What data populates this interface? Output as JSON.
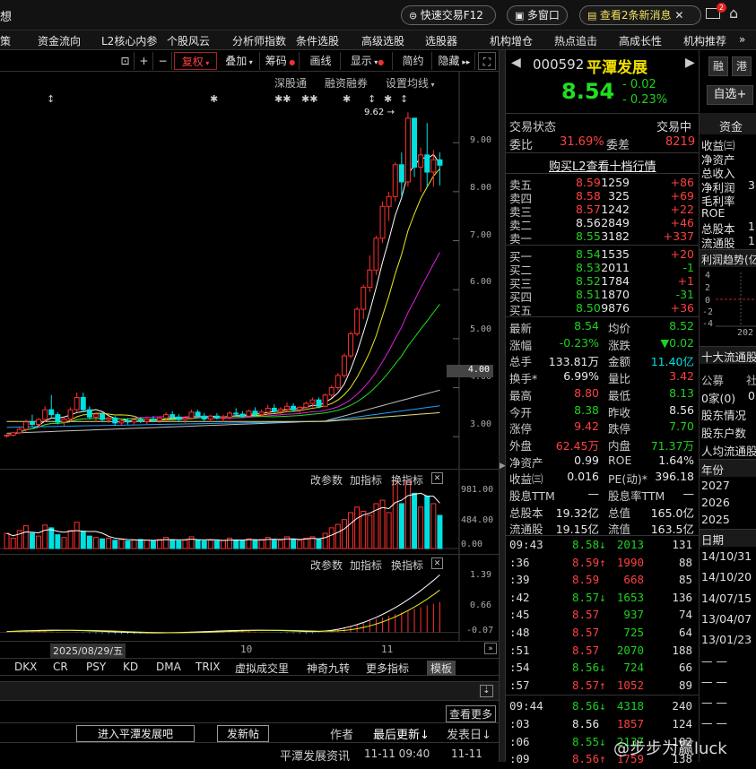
{
  "topbar": {
    "left_fragment": "想",
    "quick_trade": "快速交易F12",
    "multi_window": "多窗口",
    "news": "查看2条新消息",
    "mail_badge": "2"
  },
  "menu": [
    "策",
    "资金流向",
    "L2核心内参",
    "个股风云",
    "分析师指数",
    "条件选股",
    "高级选股",
    "选股器",
    "机构增仓",
    "热点追击",
    "高成长性",
    "机构推荐"
  ],
  "toolbar": {
    "fuquan": "复权",
    "diejia": "叠加",
    "chouma": "筹码",
    "huaxian": "画线",
    "xianshi": "显示",
    "jianyue": "简约",
    "yincang": "隐藏"
  },
  "chart_tags": {
    "shengutong": "深股通",
    "rongzi": "融资融券",
    "shezhi": "设置均线"
  },
  "chart_data": {
    "type": "candlestick",
    "price_axis": [
      "9.00",
      "8.00",
      "7.00",
      "6.00",
      "5.00",
      "4.00",
      "3.00"
    ],
    "price_range": [
      2.4,
      9.9
    ],
    "current_price_label": "4.00",
    "high_marker": "9.62",
    "candles": [
      [
        3.02,
        3.05,
        2.98,
        3.03
      ],
      [
        3.03,
        3.1,
        3.0,
        3.08
      ],
      [
        3.08,
        3.2,
        3.05,
        3.15
      ],
      [
        3.15,
        3.35,
        3.1,
        3.3
      ],
      [
        3.3,
        3.45,
        3.2,
        3.25
      ],
      [
        3.25,
        3.38,
        3.18,
        3.35
      ],
      [
        3.35,
        3.62,
        3.3,
        3.55
      ],
      [
        3.55,
        3.85,
        3.4,
        3.45
      ],
      [
        3.45,
        3.5,
        3.25,
        3.3
      ],
      [
        3.3,
        3.4,
        3.22,
        3.36
      ],
      [
        3.36,
        3.6,
        3.3,
        3.55
      ],
      [
        3.55,
        3.9,
        3.5,
        3.8
      ],
      [
        3.8,
        3.9,
        3.5,
        3.55
      ],
      [
        3.55,
        3.62,
        3.35,
        3.4
      ],
      [
        3.4,
        3.5,
        3.3,
        3.46
      ],
      [
        3.46,
        3.48,
        3.3,
        3.35
      ],
      [
        3.35,
        3.42,
        3.28,
        3.38
      ],
      [
        3.38,
        3.42,
        3.22,
        3.28
      ],
      [
        3.28,
        3.36,
        3.22,
        3.32
      ],
      [
        3.32,
        3.38,
        3.25,
        3.3
      ],
      [
        3.3,
        3.35,
        3.24,
        3.34
      ],
      [
        3.34,
        3.4,
        3.28,
        3.31
      ],
      [
        3.31,
        3.38,
        3.26,
        3.36
      ],
      [
        3.36,
        3.42,
        3.3,
        3.33
      ],
      [
        3.33,
        3.4,
        3.28,
        3.38
      ],
      [
        3.38,
        3.5,
        3.32,
        3.45
      ],
      [
        3.45,
        3.52,
        3.36,
        3.4
      ],
      [
        3.4,
        3.46,
        3.3,
        3.35
      ],
      [
        3.35,
        3.42,
        3.28,
        3.38
      ],
      [
        3.38,
        3.55,
        3.35,
        3.5
      ],
      [
        3.5,
        3.55,
        3.38,
        3.42
      ],
      [
        3.42,
        3.48,
        3.32,
        3.36
      ],
      [
        3.36,
        3.45,
        3.3,
        3.42
      ],
      [
        3.42,
        3.48,
        3.35,
        3.38
      ],
      [
        3.38,
        3.45,
        3.3,
        3.4
      ],
      [
        3.4,
        3.52,
        3.35,
        3.48
      ],
      [
        3.48,
        3.58,
        3.4,
        3.46
      ],
      [
        3.46,
        3.52,
        3.38,
        3.42
      ],
      [
        3.42,
        3.55,
        3.4,
        3.52
      ],
      [
        3.52,
        3.6,
        3.42,
        3.45
      ],
      [
        3.45,
        3.55,
        3.4,
        3.5
      ],
      [
        3.5,
        3.65,
        3.45,
        3.58
      ],
      [
        3.58,
        3.66,
        3.48,
        3.52
      ],
      [
        3.52,
        3.6,
        3.45,
        3.56
      ],
      [
        3.56,
        3.7,
        3.5,
        3.62
      ],
      [
        3.62,
        3.68,
        3.5,
        3.55
      ],
      [
        3.55,
        3.62,
        3.48,
        3.6
      ],
      [
        3.6,
        3.72,
        3.55,
        3.68
      ],
      [
        3.68,
        3.8,
        3.6,
        3.75
      ],
      [
        3.75,
        3.8,
        3.58,
        3.62
      ],
      [
        3.62,
        3.88,
        3.6,
        3.85
      ],
      [
        3.85,
        4.05,
        3.8,
        4.0
      ],
      [
        4.0,
        4.3,
        3.95,
        4.25
      ],
      [
        4.25,
        4.7,
        4.2,
        4.65
      ],
      [
        4.65,
        5.15,
        4.6,
        5.1
      ],
      [
        5.1,
        5.65,
        5.05,
        5.6
      ],
      [
        5.6,
        6.1,
        5.4,
        6.05
      ],
      [
        6.05,
        6.7,
        5.95,
        6.4
      ],
      [
        6.4,
        7.1,
        6.3,
        7.05
      ],
      [
        7.05,
        7.8,
        6.95,
        7.7
      ],
      [
        7.7,
        8.0,
        7.4,
        7.9
      ],
      [
        7.9,
        8.6,
        7.8,
        8.55
      ],
      [
        8.55,
        8.8,
        7.9,
        8.2
      ],
      [
        8.2,
        9.62,
        8.1,
        9.5
      ],
      [
        9.5,
        9.4,
        8.3,
        8.5
      ],
      [
        8.5,
        8.9,
        8.0,
        8.75
      ],
      [
        8.75,
        9.4,
        8.1,
        8.4
      ],
      [
        8.4,
        8.85,
        8.1,
        8.65
      ],
      [
        8.65,
        8.8,
        8.13,
        8.54
      ]
    ],
    "vol_axis": [
      "981.00",
      "484.00",
      "0.00"
    ],
    "vol_max": 1000,
    "volumes": [
      220,
      150,
      260,
      330,
      220,
      180,
      340,
      300,
      200,
      160,
      260,
      380,
      250,
      180,
      160,
      140,
      150,
      120,
      130,
      110,
      120,
      130,
      120,
      110,
      130,
      160,
      120,
      110,
      120,
      170,
      120,
      110,
      120,
      110,
      120,
      150,
      120,
      110,
      140,
      120,
      130,
      160,
      120,
      120,
      170,
      130,
      120,
      150,
      170,
      130,
      220,
      300,
      350,
      420,
      520,
      600,
      540,
      480,
      650,
      700,
      520,
      980,
      650,
      980,
      800,
      600,
      760,
      650,
      480
    ],
    "macd_axis": [
      "1.39",
      "0.66",
      "-0.07"
    ],
    "date_label": "2025/08/29/五",
    "x_ticks": [
      "10",
      "11"
    ]
  },
  "panel_labels": {
    "gaicanshu": "改参数",
    "jiazhibiao": "加指标",
    "huanzhibiao": "换指标"
  },
  "indicators": [
    "DKX",
    "CR",
    "PSY",
    "KD",
    "DMA",
    "TRIX",
    "虚拟成交里",
    "神奇九转",
    "更多指标",
    "模板"
  ],
  "bottom": {
    "more_news": "查看更多",
    "enter_bar": "进入平潭发展吧",
    "post": "发新帖",
    "author": "作者",
    "last_update": "最后更新↓",
    "post_date": "发表日↓",
    "news_title": "平潭发展资讯",
    "news_time": "11-11 09:40",
    "news_date": "11-11"
  },
  "quote": {
    "code": "000592",
    "name": "平潭发展",
    "btn_rong": "融",
    "btn_gang": "港",
    "price": "8.54",
    "change": "- 0.02",
    "change_pct": "- 0.23%",
    "zixuan": "自选+",
    "status_label": "交易状态",
    "status": "交易中",
    "webi_label": "委比",
    "webi": "31.69%",
    "wecha_label": "委差",
    "wecha": "8219",
    "l2_link": "购买L2查看十档行情"
  },
  "asks": [
    {
      "label": "卖五",
      "price": "8.59",
      "vol": "1259",
      "chg": "+86"
    },
    {
      "label": "卖四",
      "price": "8.58",
      "vol": "325",
      "chg": "+69"
    },
    {
      "label": "卖三",
      "price": "8.57",
      "vol": "1242",
      "chg": "+22"
    },
    {
      "label": "卖二",
      "price": "8.56",
      "vol": "2849",
      "chg": "+46"
    },
    {
      "label": "卖一",
      "price": "8.55",
      "vol": "3182",
      "chg": "+337"
    }
  ],
  "bids": [
    {
      "label": "买一",
      "price": "8.54",
      "vol": "1535",
      "chg": "+20"
    },
    {
      "label": "买二",
      "price": "8.53",
      "vol": "2011",
      "chg": "-1"
    },
    {
      "label": "买三",
      "price": "8.52",
      "vol": "1784",
      "chg": "+1"
    },
    {
      "label": "买四",
      "price": "8.51",
      "vol": "1870",
      "chg": "-31"
    },
    {
      "label": "买五",
      "price": "8.50",
      "vol": "9876",
      "chg": "+36"
    }
  ],
  "stats": [
    {
      "l1": "最新",
      "v1": "8.54",
      "c1": "green",
      "l2": "均价",
      "v2": "8.52",
      "c2": "green"
    },
    {
      "l1": "涨幅",
      "v1": "-0.23%",
      "c1": "green",
      "l2": "涨跌",
      "v2": "▼0.02",
      "c2": "green"
    },
    {
      "l1": "总手",
      "v1": "133.81万",
      "c1": "white",
      "l2": "金额",
      "v2": "11.40亿",
      "c2": "cyan"
    },
    {
      "l1": "换手*",
      "v1": "6.99%",
      "c1": "white",
      "l2": "量比",
      "v2": "3.42",
      "c2": "red"
    },
    {
      "l1": "最高",
      "v1": "8.80",
      "c1": "red",
      "l2": "最低",
      "v2": "8.13",
      "c2": "green"
    },
    {
      "l1": "今开",
      "v1": "8.38",
      "c1": "green",
      "l2": "昨收",
      "v2": "8.56",
      "c2": "white"
    },
    {
      "l1": "涨停",
      "v1": "9.42",
      "c1": "red",
      "l2": "跌停",
      "v2": "7.70",
      "c2": "green"
    },
    {
      "l1": "外盘",
      "v1": "62.45万",
      "c1": "red",
      "l2": "内盘",
      "v2": "71.37万",
      "c2": "green"
    },
    {
      "l1": "净资产",
      "v1": "0.99",
      "c1": "white",
      "l2": "ROE",
      "v2": "1.64%",
      "c2": "white"
    },
    {
      "l1": "收益㈢",
      "v1": "0.016",
      "c1": "white",
      "l2": "PE(动)*",
      "v2": "396.18",
      "c2": "white"
    },
    {
      "l1": "股息TTM",
      "v1": "—",
      "c1": "white",
      "l2": "股息率TTM",
      "v2": "—",
      "c2": "white"
    },
    {
      "l1": "总股本",
      "v1": "19.32亿",
      "c1": "white",
      "l2": "总值",
      "v2": "165.0亿",
      "c2": "white"
    },
    {
      "l1": "流通股",
      "v1": "19.15亿",
      "c1": "white",
      "l2": "流值",
      "v2": "163.5亿",
      "c2": "white"
    }
  ],
  "ticks": [
    {
      "t": "09:43",
      "p": "8.58",
      "arrow": "↓",
      "ac": "green",
      "v": "2013",
      "vc": "green",
      "n": "131"
    },
    {
      "t": ":36",
      "p": "8.59",
      "arrow": "↑",
      "ac": "red",
      "v": "1990",
      "vc": "red",
      "n": "88"
    },
    {
      "t": ":39",
      "p": "8.59",
      "arrow": "",
      "ac": "red",
      "v": "668",
      "vc": "red",
      "n": "85"
    },
    {
      "t": ":42",
      "p": "8.57",
      "arrow": "↓",
      "ac": "green",
      "v": "1653",
      "vc": "green",
      "n": "136"
    },
    {
      "t": ":45",
      "p": "8.57",
      "arrow": "",
      "ac": "red",
      "v": "937",
      "vc": "green",
      "n": "74"
    },
    {
      "t": ":48",
      "p": "8.57",
      "arrow": "",
      "ac": "red",
      "v": "725",
      "vc": "green",
      "n": "64"
    },
    {
      "t": ":51",
      "p": "8.57",
      "arrow": "",
      "ac": "red",
      "v": "2070",
      "vc": "green",
      "n": "188"
    },
    {
      "t": ":54",
      "p": "8.56",
      "arrow": "↓",
      "ac": "green",
      "v": "724",
      "vc": "green",
      "n": "66"
    },
    {
      "t": ":57",
      "p": "8.57",
      "arrow": "↑",
      "ac": "red",
      "v": "1052",
      "vc": "red",
      "n": "89"
    },
    {
      "t": "09:44",
      "p": "8.56",
      "arrow": "↓",
      "ac": "green",
      "v": "4318",
      "vc": "green",
      "n": "240"
    },
    {
      "t": ":03",
      "p": "8.56",
      "arrow": "",
      "ac": "white",
      "v": "1857",
      "vc": "red",
      "n": "124"
    },
    {
      "t": ":06",
      "p": "8.55",
      "arrow": "↓",
      "ac": "green",
      "v": "2137",
      "vc": "green",
      "n": "102"
    },
    {
      "t": ":09",
      "p": "8.56",
      "arrow": "↑",
      "ac": "red",
      "v": "1759",
      "vc": "red",
      "n": "138"
    }
  ],
  "far_right": {
    "zijin": "资金",
    "items": [
      "收益㈢",
      "净资产",
      "总收入",
      "净利润",
      "毛利率",
      "ROE",
      "总股本",
      "流通股"
    ],
    "vals": [
      "",
      "",
      "",
      "3",
      "",
      "",
      "1",
      "1"
    ],
    "profit_trend": "利润趋势(亿",
    "trend_axis": [
      "4",
      "2",
      "0",
      "-2",
      "-4"
    ],
    "trend_year": "202",
    "top10": "十大流通股",
    "gonggao": "公募",
    "she": "社",
    "jia": "0家(0)",
    "jia2": "0",
    "gudong": "股东情况",
    "hushu": "股东户数",
    "renjun": "人均流通股",
    "nianfen": "年份",
    "years": [
      "2027",
      "2026",
      "2025"
    ],
    "riqi": "日期",
    "dates": [
      "14/10/31",
      "14/10/20",
      "14/07/15",
      "13/04/07",
      "13/01/23",
      "— —",
      "— —",
      "— —",
      "— —"
    ]
  },
  "watermark": "@步步为赢luck"
}
